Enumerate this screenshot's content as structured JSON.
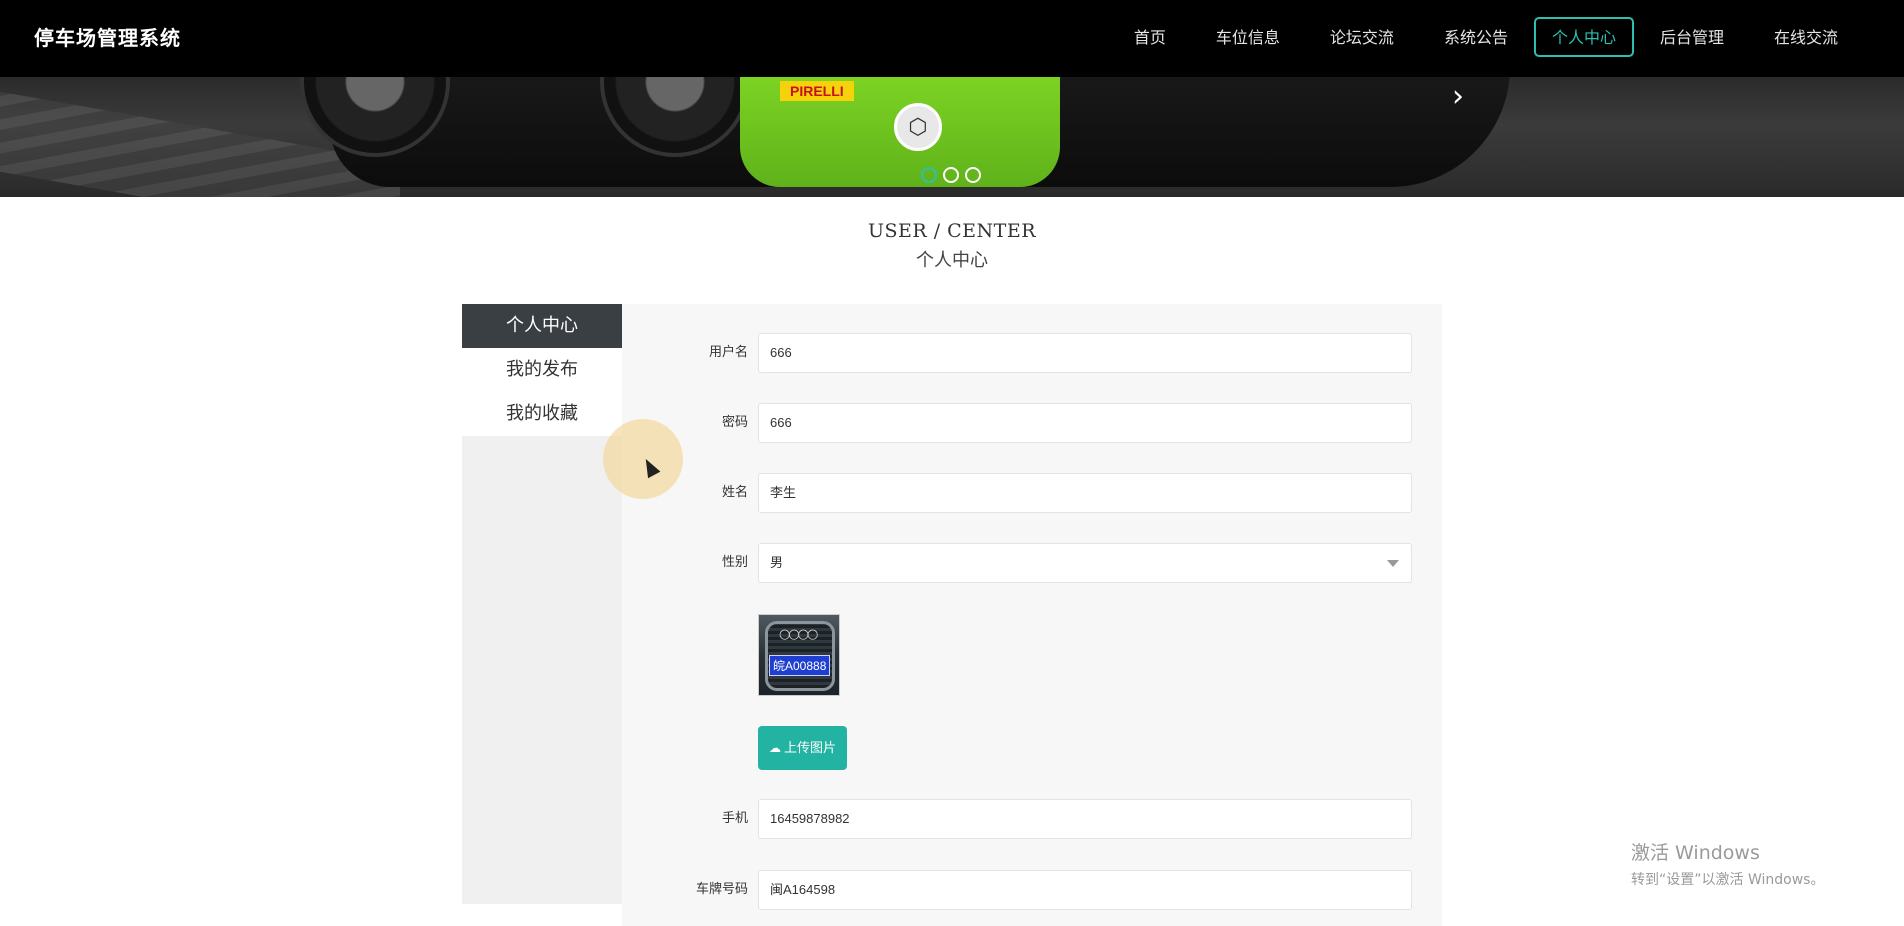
{
  "header": {
    "brand": "停车场管理系统",
    "nav": [
      {
        "label": "首页"
      },
      {
        "label": "车位信息"
      },
      {
        "label": "论坛交流"
      },
      {
        "label": "系统公告"
      },
      {
        "label": "个人中心",
        "active": true
      },
      {
        "label": "后台管理"
      },
      {
        "label": "在线交流"
      }
    ]
  },
  "banner": {
    "tire_brand": "PIRELLI",
    "slide_count": 3,
    "active_slide": 1
  },
  "section": {
    "title_en": "USER / CENTER",
    "title_cn": "个人中心"
  },
  "sidebar": {
    "items": [
      {
        "label": "个人中心",
        "active": true
      },
      {
        "label": "我的发布"
      },
      {
        "label": "我的收藏"
      }
    ]
  },
  "form": {
    "username": {
      "label": "用户名",
      "value": "666"
    },
    "password": {
      "label": "密码",
      "value": "666"
    },
    "name": {
      "label": "姓名",
      "value": "李生"
    },
    "gender": {
      "label": "性别",
      "value": "男"
    },
    "avatar": {
      "plate_text": "皖A00888"
    },
    "upload_label": "上传图片",
    "phone": {
      "label": "手机",
      "value": "16459878982"
    },
    "plate": {
      "label": "车牌号码",
      "value": "闽A164598"
    }
  },
  "watermark": {
    "line1": "激活 Windows",
    "line2": "转到“设置”以激活 Windows。"
  },
  "colors": {
    "accent": "#2ebfb1",
    "button": "#22b3a2",
    "sidebar_active": "#3a3f44",
    "topbar": "#000000"
  }
}
